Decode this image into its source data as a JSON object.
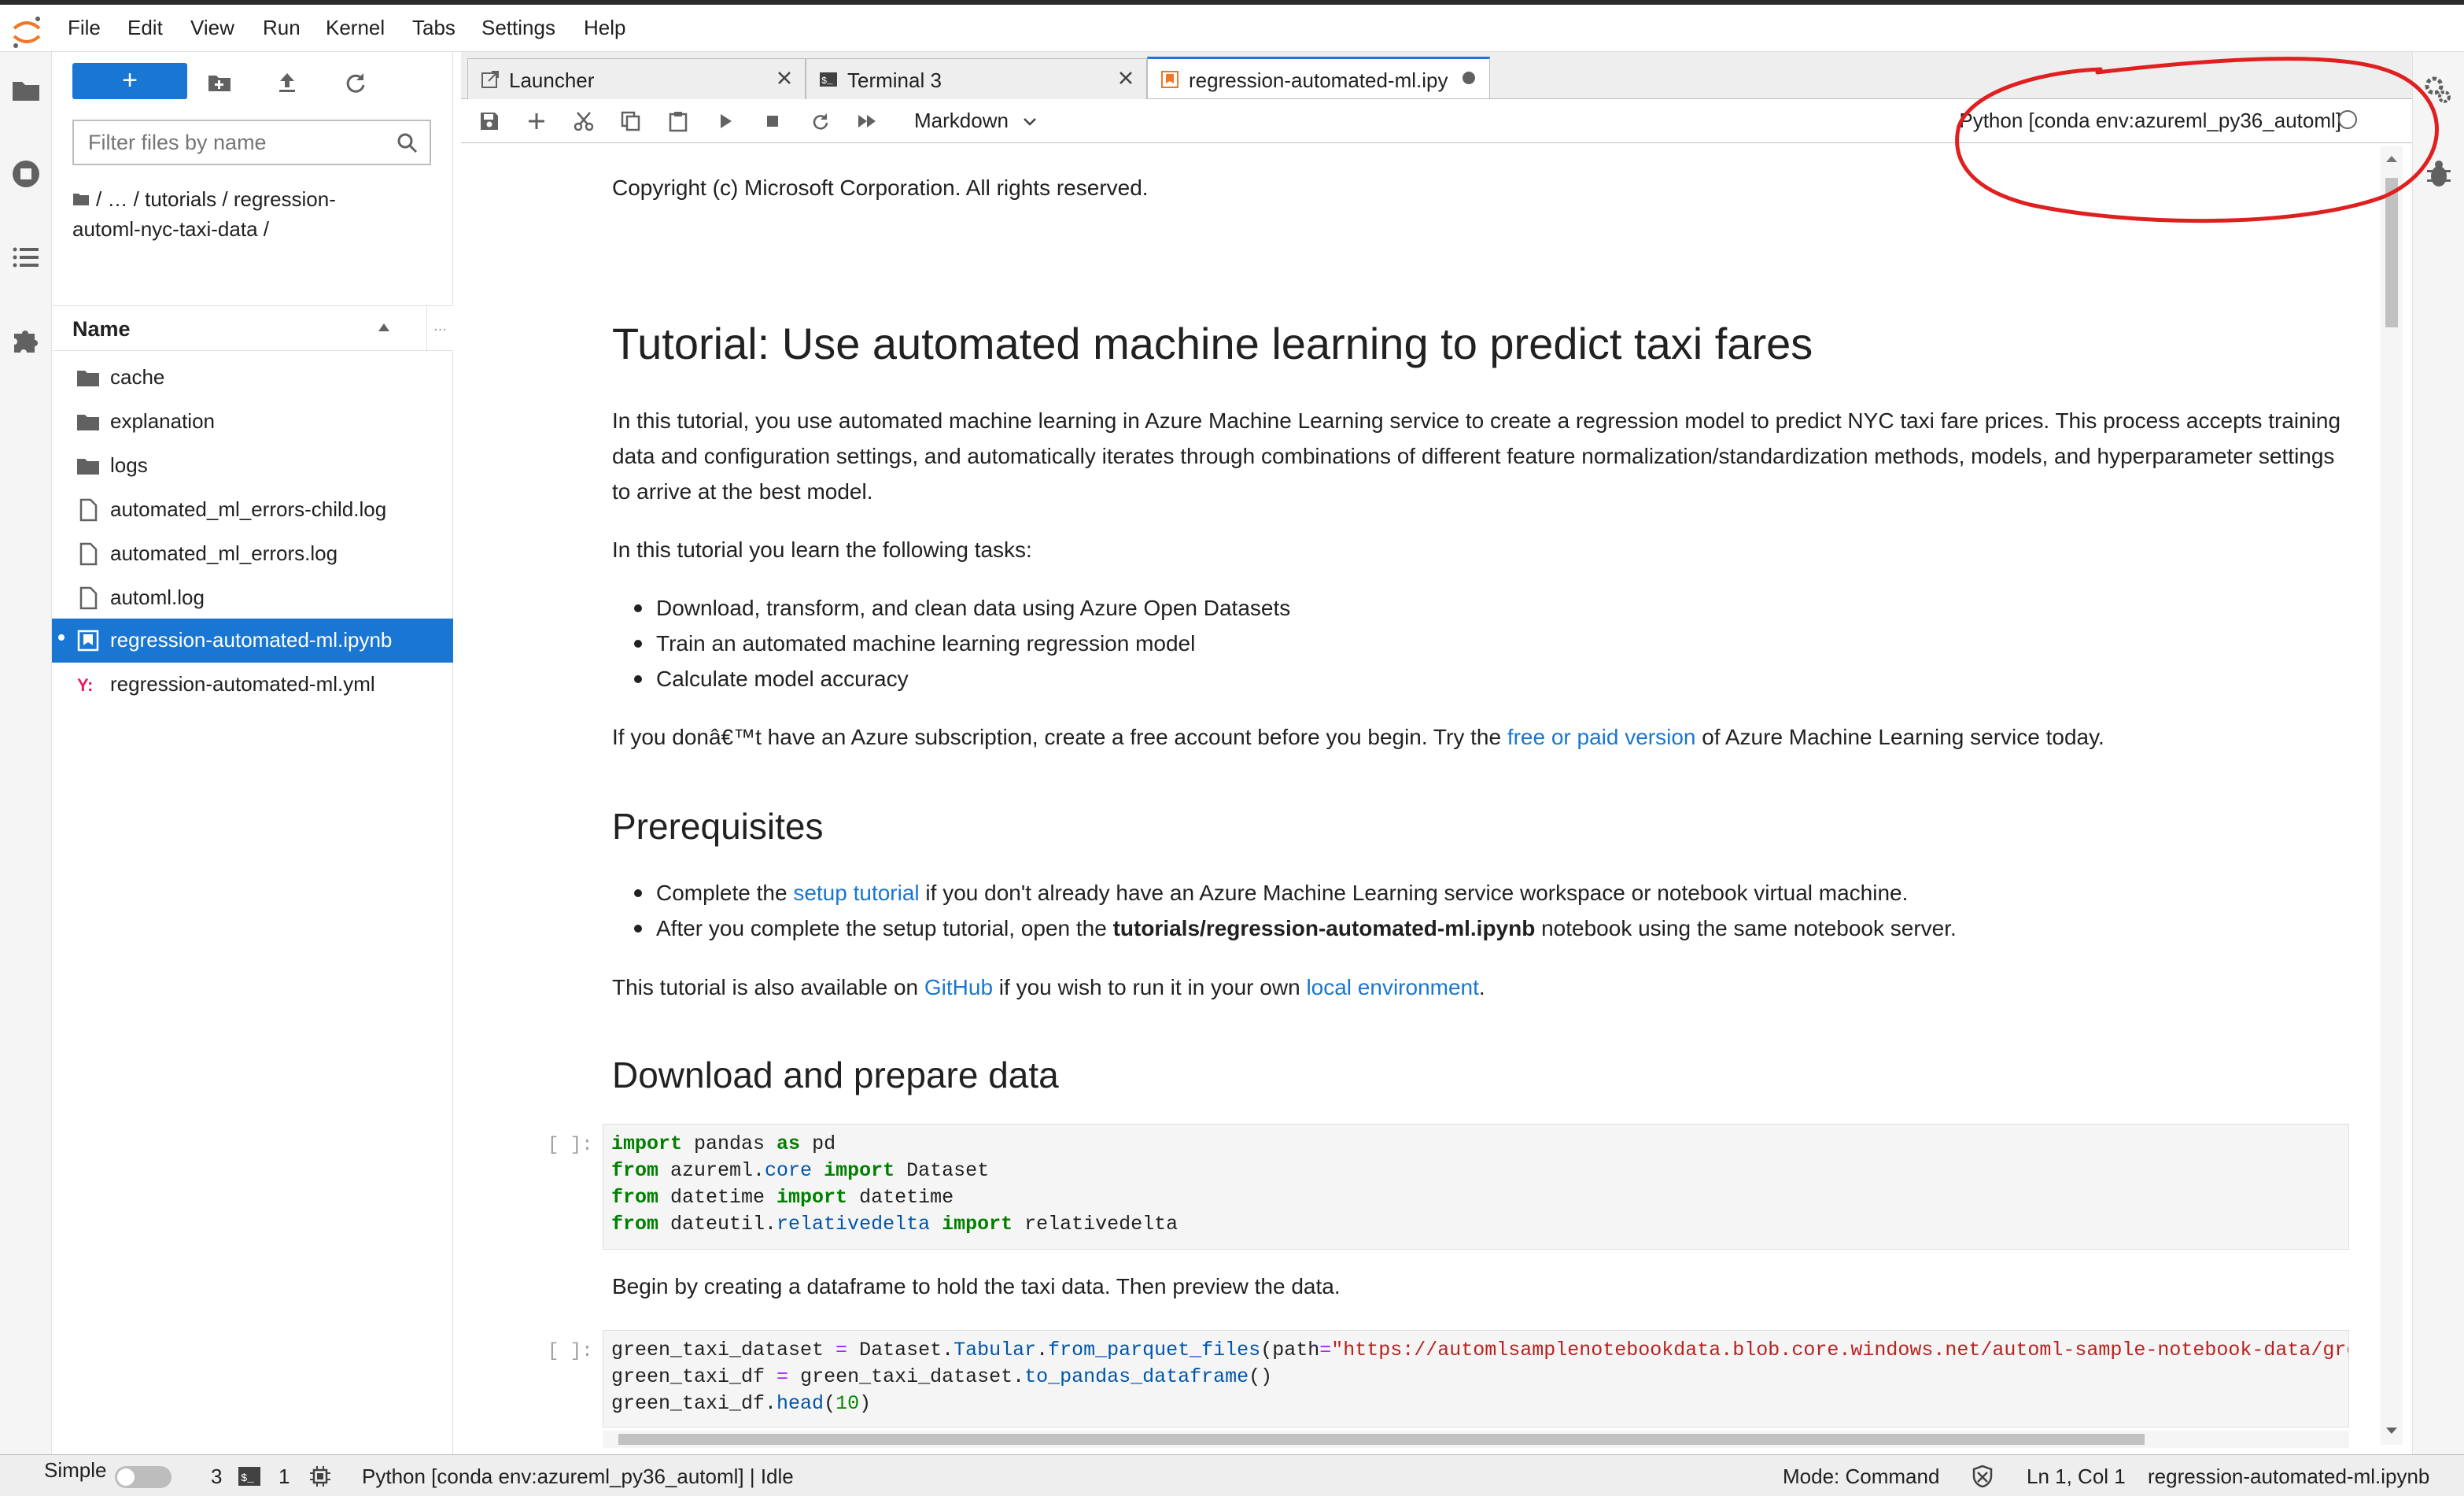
{
  "menu": [
    "File",
    "Edit",
    "View",
    "Run",
    "Kernel",
    "Tabs",
    "Settings",
    "Help"
  ],
  "filebrowser": {
    "new_label": "+",
    "filter_placeholder": "Filter files by name",
    "breadcrumb_line1": "/   …  / tutorials / regression-",
    "breadcrumb_line2": "automl-nyc-taxi-data /",
    "column_name": "Name",
    "items": [
      {
        "name": "cache",
        "type": "folder"
      },
      {
        "name": "explanation",
        "type": "folder"
      },
      {
        "name": "logs",
        "type": "folder"
      },
      {
        "name": "automated_ml_errors-child.log",
        "type": "file"
      },
      {
        "name": "automated_ml_errors.log",
        "type": "file"
      },
      {
        "name": "automl.log",
        "type": "file"
      },
      {
        "name": "regression-automated-ml.ipynb",
        "type": "notebook",
        "selected": true
      },
      {
        "name": "regression-automated-ml.yml",
        "type": "yaml"
      }
    ]
  },
  "tabs": [
    {
      "label": "Launcher"
    },
    {
      "label": "Terminal 3"
    },
    {
      "label": "regression-automated-ml.ipy"
    }
  ],
  "toolbar": {
    "cell_type": "Markdown",
    "kernel": "Python [conda env:azureml_py36_automl]"
  },
  "notebook": {
    "copyright": "Copyright (c) Microsoft Corporation. All rights reserved.",
    "title": "Tutorial: Use automated machine learning to predict taxi fares",
    "intro": "In this tutorial, you use automated machine learning in Azure Machine Learning service to create a regression model to predict NYC taxi fare prices. This process accepts training data and configuration settings, and automatically iterates through combinations of different feature normalization/standardization methods, models, and hyperparameter settings to arrive at the best model.",
    "learn": "In this tutorial you learn the following tasks:",
    "tasks": [
      "Download, transform, and clean data using Azure Open Datasets",
      "Train an automated machine learning regression model",
      "Calculate model accuracy"
    ],
    "sub_pre": "If you donâ€™t have an Azure subscription, create a free account before you begin. Try the ",
    "sub_link": "free or paid version",
    "sub_post": " of Azure Machine Learning service today.",
    "prereq_heading": "Prerequisites",
    "prereq1_pre": "Complete the ",
    "prereq1_link": "setup tutorial",
    "prereq1_post": " if you don't already have an Azure Machine Learning service workspace or notebook virtual machine.",
    "prereq2_pre": "After you complete the setup tutorial, open the ",
    "prereq2_bold": "tutorials/regression-automated-ml.ipynb",
    "prereq2_post": " notebook using the same notebook server.",
    "avail_pre": "This tutorial is also available on ",
    "avail_link1": "GitHub",
    "avail_mid": " if you wish to run it in your own ",
    "avail_link2": "local environment",
    "avail_post": ".",
    "download_heading": "Download and prepare data",
    "prompt": "[ ]:",
    "begin": "Begin by creating a dataframe to hold the taxi data. Then preview the data."
  },
  "code1": [
    {
      "kw1": "import",
      "t1": " pandas ",
      "kw2": "as",
      "t2": " pd"
    },
    {
      "kw1": "from",
      "t1": " azureml.",
      "fn": "core",
      "kw2": " import",
      "t2": " Dataset"
    },
    {
      "kw1": "from",
      "t1": " datetime ",
      "kw2": "import",
      "t2": " datetime"
    },
    {
      "kw1": "from",
      "t1": " dateutil.",
      "fn": "relativedelta",
      "kw2": " import",
      "t2": " relativedelta"
    }
  ],
  "code2": {
    "l1a": "green_taxi_dataset ",
    "l1op": "=",
    "l1b": " Dataset.",
    "l1fn1": "Tabular",
    "l1c": ".",
    "l1fn2": "from_parquet_files",
    "l1d": "(path",
    "l1op2": "=",
    "l1str": "\"https://automlsamplenotebookdata.blob.core.windows.net/automl-sample-notebook-data/green_ta",
    "l2a": "green_taxi_df ",
    "l2op": "=",
    "l2b": " green_taxi_dataset.",
    "l2fn": "to_pandas_dataframe",
    "l2c": "()",
    "l3a": "green_taxi_df.",
    "l3fn": "head",
    "l3b": "(",
    "l3num": "10",
    "l3c": ")"
  },
  "statusbar": {
    "simple": "Simple",
    "terminals": "3",
    "kernels": "1",
    "kernel_status": "Python [conda env:azureml_py36_automl] | Idle",
    "mode": "Mode: Command",
    "position": "Ln 1, Col 1",
    "filename": "regression-automated-ml.ipynb"
  },
  "colors": {
    "accent": "#1976d2",
    "annotation": "#e02020"
  }
}
